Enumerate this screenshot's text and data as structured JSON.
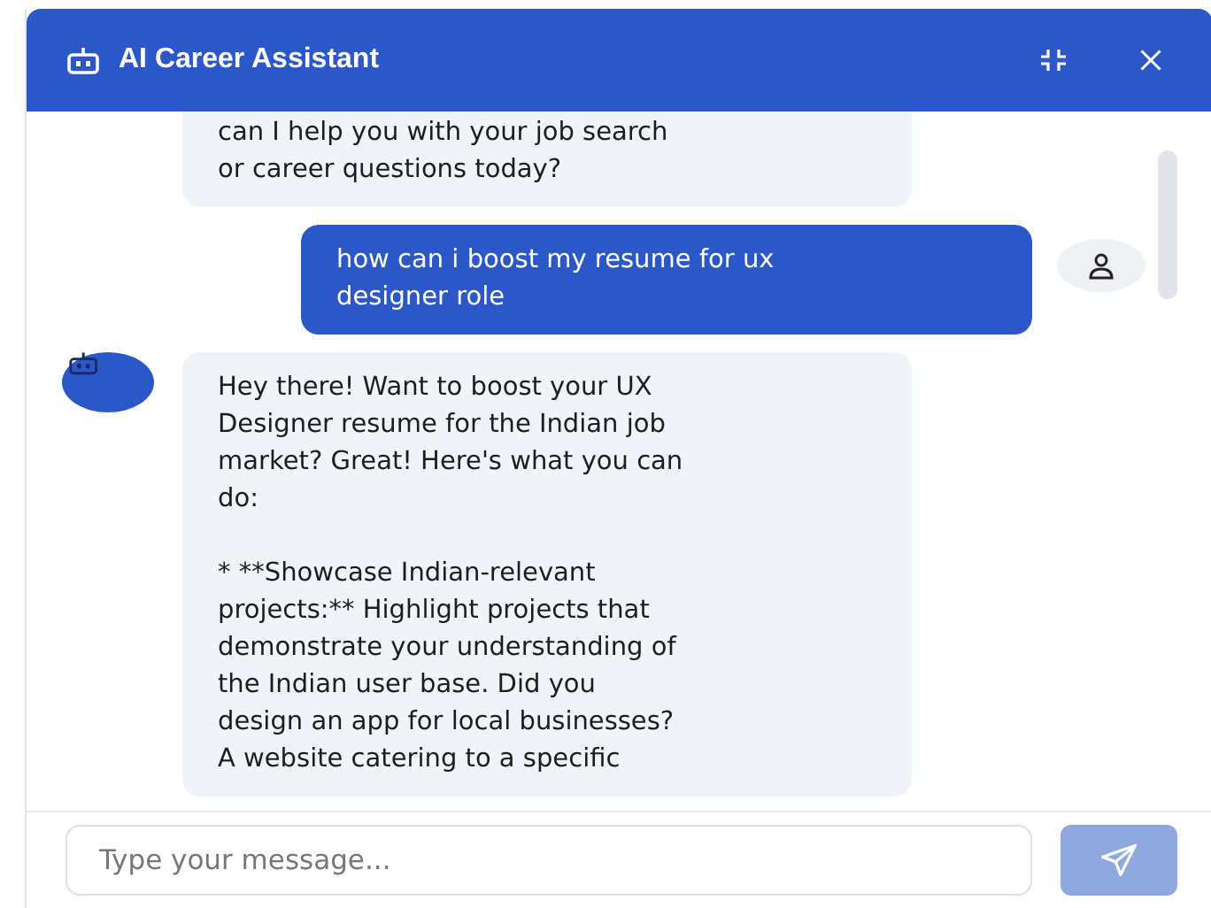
{
  "header": {
    "title": "AI Career Assistant"
  },
  "messages": [
    {
      "kind": "bot",
      "cut": true,
      "text": "can I help you with your job search\nor career questions today?"
    },
    {
      "kind": "user",
      "text": "how can i boost my resume for ux\ndesigner role"
    },
    {
      "kind": "bot",
      "cut": false,
      "text": "Hey there! Want to boost your UX\nDesigner resume for the Indian job\nmarket? Great! Here's what you can\ndo:\n\n* **Showcase Indian-relevant\nprojects:** Highlight projects that\ndemonstrate your understanding of\nthe Indian user base. Did you\ndesign an app for local businesses?\nA website catering to a specific"
    }
  ],
  "composer": {
    "placeholder": "Type your message...",
    "send_disabled": true
  }
}
